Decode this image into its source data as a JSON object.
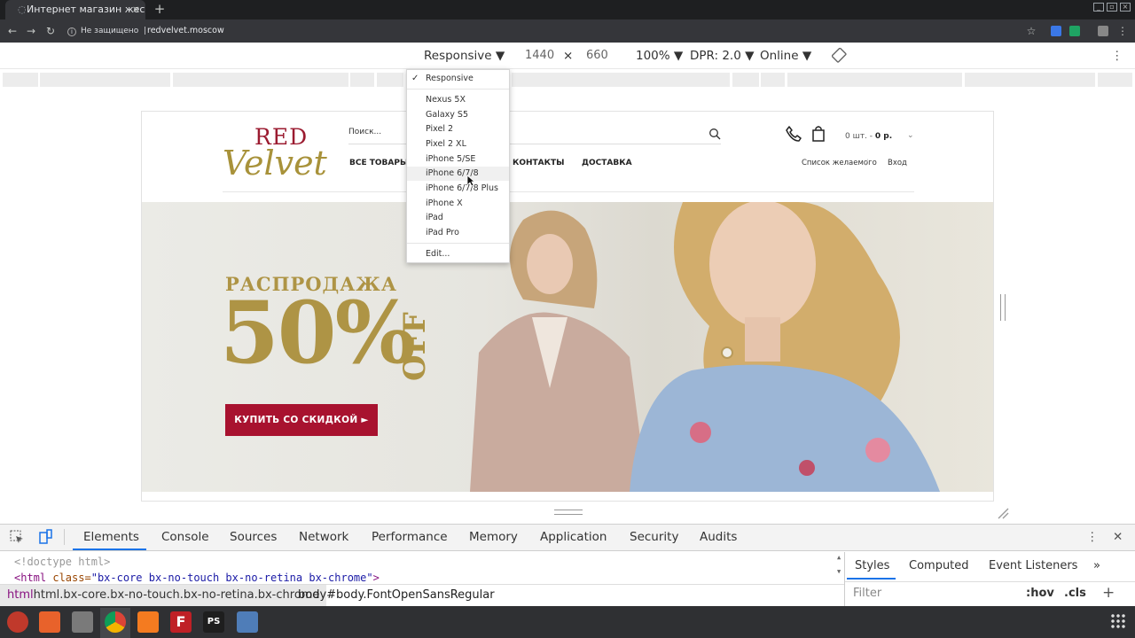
{
  "browser": {
    "tab_title": "Интернет магазин жеско",
    "tab_close": "×",
    "new_tab": "+",
    "security": "Не защищено",
    "separator": "|",
    "url": "redvelvet.moscow"
  },
  "device_toolbar": {
    "device": "Responsive",
    "width": "1440",
    "times": "×",
    "height": "660",
    "zoom": "100%",
    "dpr": "DPR: 2.0",
    "network": "Online"
  },
  "device_menu": {
    "checked": "✓",
    "selected": "Responsive",
    "items": [
      "Nexus 5X",
      "Galaxy S5",
      "Pixel 2",
      "Pixel 2 XL",
      "iPhone 5/SE",
      "iPhone 6/7/8",
      "iPhone 6/7/8 Plus",
      "iPhone X",
      "iPad",
      "iPad Pro"
    ],
    "edit": "Edit..."
  },
  "site": {
    "logo_top": "RED",
    "logo_bottom": "Velvet",
    "search_placeholder": "Поиск...",
    "nav": [
      "ВСЕ ТОВАРЫ",
      "КОНТАКТЫ",
      "ДОСТАВКА"
    ],
    "cart_prefix": "0 шт. - ",
    "cart_sum": "0 р.",
    "wishlist": "Список желаемого",
    "login": "Вход",
    "banner_sale": "РАСПРОДАЖА",
    "banner_percent": "50%",
    "banner_off": "OFF",
    "cta": "КУПИТЬ СО СКИДКОЙ  ►"
  },
  "devtools": {
    "tabs": [
      "Elements",
      "Console",
      "Sources",
      "Network",
      "Performance",
      "Memory",
      "Application",
      "Security",
      "Audits"
    ],
    "active_tab": "Elements",
    "line1": "<!doctype html>",
    "line2_tag": "<html ",
    "line2_attr": "class=",
    "line2_val": "\"bx-core bx-no-touch bx-no-retina bx-chrome\"",
    "line2_end": ">",
    "crumb1": "html.bx-core.bx-no-touch.bx-no-retina.bx-chrome",
    "crumb2": "body#body.FontOpenSansRegular",
    "style_tabs": [
      "Styles",
      "Computed",
      "Event Listeners"
    ],
    "more": "»",
    "filter": "Filter",
    "hov": ":hov",
    "cls": ".cls",
    "plus": "+"
  },
  "colors": {
    "accent": "#1a73e8",
    "brand": "#a8122f",
    "gold": "#ae9445"
  }
}
